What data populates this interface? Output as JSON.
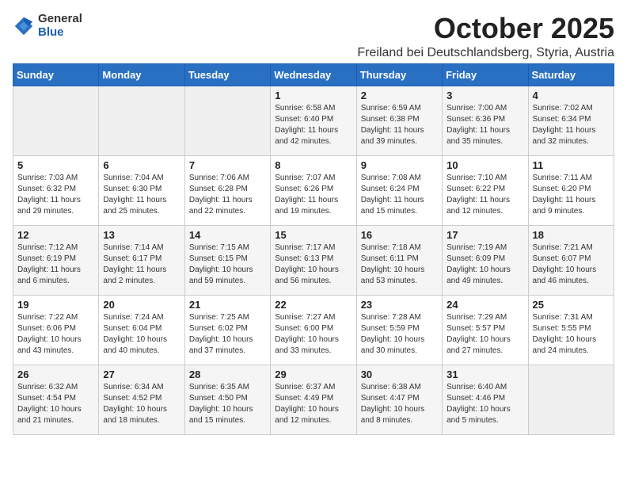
{
  "logo": {
    "general": "General",
    "blue": "Blue"
  },
  "title": "October 2025",
  "location": "Freiland bei Deutschlandsberg, Styria, Austria",
  "days_of_week": [
    "Sunday",
    "Monday",
    "Tuesday",
    "Wednesday",
    "Thursday",
    "Friday",
    "Saturday"
  ],
  "weeks": [
    [
      {
        "day": "",
        "info": ""
      },
      {
        "day": "",
        "info": ""
      },
      {
        "day": "",
        "info": ""
      },
      {
        "day": "1",
        "info": "Sunrise: 6:58 AM\nSunset: 6:40 PM\nDaylight: 11 hours and 42 minutes."
      },
      {
        "day": "2",
        "info": "Sunrise: 6:59 AM\nSunset: 6:38 PM\nDaylight: 11 hours and 39 minutes."
      },
      {
        "day": "3",
        "info": "Sunrise: 7:00 AM\nSunset: 6:36 PM\nDaylight: 11 hours and 35 minutes."
      },
      {
        "day": "4",
        "info": "Sunrise: 7:02 AM\nSunset: 6:34 PM\nDaylight: 11 hours and 32 minutes."
      }
    ],
    [
      {
        "day": "5",
        "info": "Sunrise: 7:03 AM\nSunset: 6:32 PM\nDaylight: 11 hours and 29 minutes."
      },
      {
        "day": "6",
        "info": "Sunrise: 7:04 AM\nSunset: 6:30 PM\nDaylight: 11 hours and 25 minutes."
      },
      {
        "day": "7",
        "info": "Sunrise: 7:06 AM\nSunset: 6:28 PM\nDaylight: 11 hours and 22 minutes."
      },
      {
        "day": "8",
        "info": "Sunrise: 7:07 AM\nSunset: 6:26 PM\nDaylight: 11 hours and 19 minutes."
      },
      {
        "day": "9",
        "info": "Sunrise: 7:08 AM\nSunset: 6:24 PM\nDaylight: 11 hours and 15 minutes."
      },
      {
        "day": "10",
        "info": "Sunrise: 7:10 AM\nSunset: 6:22 PM\nDaylight: 11 hours and 12 minutes."
      },
      {
        "day": "11",
        "info": "Sunrise: 7:11 AM\nSunset: 6:20 PM\nDaylight: 11 hours and 9 minutes."
      }
    ],
    [
      {
        "day": "12",
        "info": "Sunrise: 7:12 AM\nSunset: 6:19 PM\nDaylight: 11 hours and 6 minutes."
      },
      {
        "day": "13",
        "info": "Sunrise: 7:14 AM\nSunset: 6:17 PM\nDaylight: 11 hours and 2 minutes."
      },
      {
        "day": "14",
        "info": "Sunrise: 7:15 AM\nSunset: 6:15 PM\nDaylight: 10 hours and 59 minutes."
      },
      {
        "day": "15",
        "info": "Sunrise: 7:17 AM\nSunset: 6:13 PM\nDaylight: 10 hours and 56 minutes."
      },
      {
        "day": "16",
        "info": "Sunrise: 7:18 AM\nSunset: 6:11 PM\nDaylight: 10 hours and 53 minutes."
      },
      {
        "day": "17",
        "info": "Sunrise: 7:19 AM\nSunset: 6:09 PM\nDaylight: 10 hours and 49 minutes."
      },
      {
        "day": "18",
        "info": "Sunrise: 7:21 AM\nSunset: 6:07 PM\nDaylight: 10 hours and 46 minutes."
      }
    ],
    [
      {
        "day": "19",
        "info": "Sunrise: 7:22 AM\nSunset: 6:06 PM\nDaylight: 10 hours and 43 minutes."
      },
      {
        "day": "20",
        "info": "Sunrise: 7:24 AM\nSunset: 6:04 PM\nDaylight: 10 hours and 40 minutes."
      },
      {
        "day": "21",
        "info": "Sunrise: 7:25 AM\nSunset: 6:02 PM\nDaylight: 10 hours and 37 minutes."
      },
      {
        "day": "22",
        "info": "Sunrise: 7:27 AM\nSunset: 6:00 PM\nDaylight: 10 hours and 33 minutes."
      },
      {
        "day": "23",
        "info": "Sunrise: 7:28 AM\nSunset: 5:59 PM\nDaylight: 10 hours and 30 minutes."
      },
      {
        "day": "24",
        "info": "Sunrise: 7:29 AM\nSunset: 5:57 PM\nDaylight: 10 hours and 27 minutes."
      },
      {
        "day": "25",
        "info": "Sunrise: 7:31 AM\nSunset: 5:55 PM\nDaylight: 10 hours and 24 minutes."
      }
    ],
    [
      {
        "day": "26",
        "info": "Sunrise: 6:32 AM\nSunset: 4:54 PM\nDaylight: 10 hours and 21 minutes."
      },
      {
        "day": "27",
        "info": "Sunrise: 6:34 AM\nSunset: 4:52 PM\nDaylight: 10 hours and 18 minutes."
      },
      {
        "day": "28",
        "info": "Sunrise: 6:35 AM\nSunset: 4:50 PM\nDaylight: 10 hours and 15 minutes."
      },
      {
        "day": "29",
        "info": "Sunrise: 6:37 AM\nSunset: 4:49 PM\nDaylight: 10 hours and 12 minutes."
      },
      {
        "day": "30",
        "info": "Sunrise: 6:38 AM\nSunset: 4:47 PM\nDaylight: 10 hours and 8 minutes."
      },
      {
        "day": "31",
        "info": "Sunrise: 6:40 AM\nSunset: 4:46 PM\nDaylight: 10 hours and 5 minutes."
      },
      {
        "day": "",
        "info": ""
      }
    ]
  ]
}
